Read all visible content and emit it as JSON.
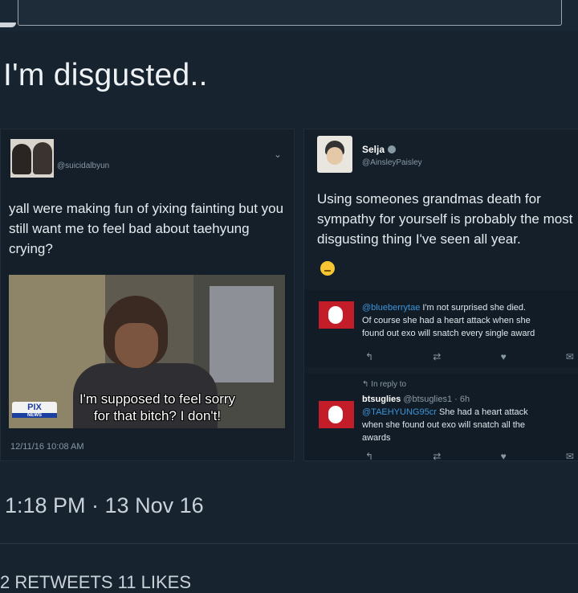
{
  "tweet": {
    "text": "I'm disgusted..",
    "time": "1:18 PM · 13 Nov 16",
    "stats_label": "2 RETWEETS 11 LIKES"
  },
  "left_card": {
    "handle": "@suicidalbyun",
    "body": "yall were making fun of yixing fainting but you still want me to feel bad about taehyung crying?",
    "video_caption_line1": "I'm supposed to feel sorry",
    "video_caption_line2": "for that bitch? I don't!",
    "video_logo": "PIX",
    "video_logo_sub": "NEWS",
    "timestamp": "12/11/16 10:08 AM"
  },
  "right_card": {
    "name": "Selja",
    "handle": "@AinsleyPaisley",
    "body": "Using someones grandmas death for sympathy for yourself is probably the most disgusting thing I've seen all year.",
    "replies": [
      {
        "mention": "@blueberrytae",
        "line1": "I'm not surprised she died.",
        "line2": "Of course she had a heart attack when she",
        "line3": "found out exo will snatch every single award"
      },
      {
        "in_reply_to": "In reply to",
        "name": "btsuglies",
        "handle": "@btsuglies1 · 6h",
        "mention": "@TAEHYUNG95cr",
        "line1": "She had a heart attack",
        "line2": "when she found out exo will snatch all the",
        "line3": "awards"
      }
    ]
  },
  "colors": {
    "background": "#17232f",
    "link": "#3b94d9",
    "muted": "#8899a6"
  }
}
